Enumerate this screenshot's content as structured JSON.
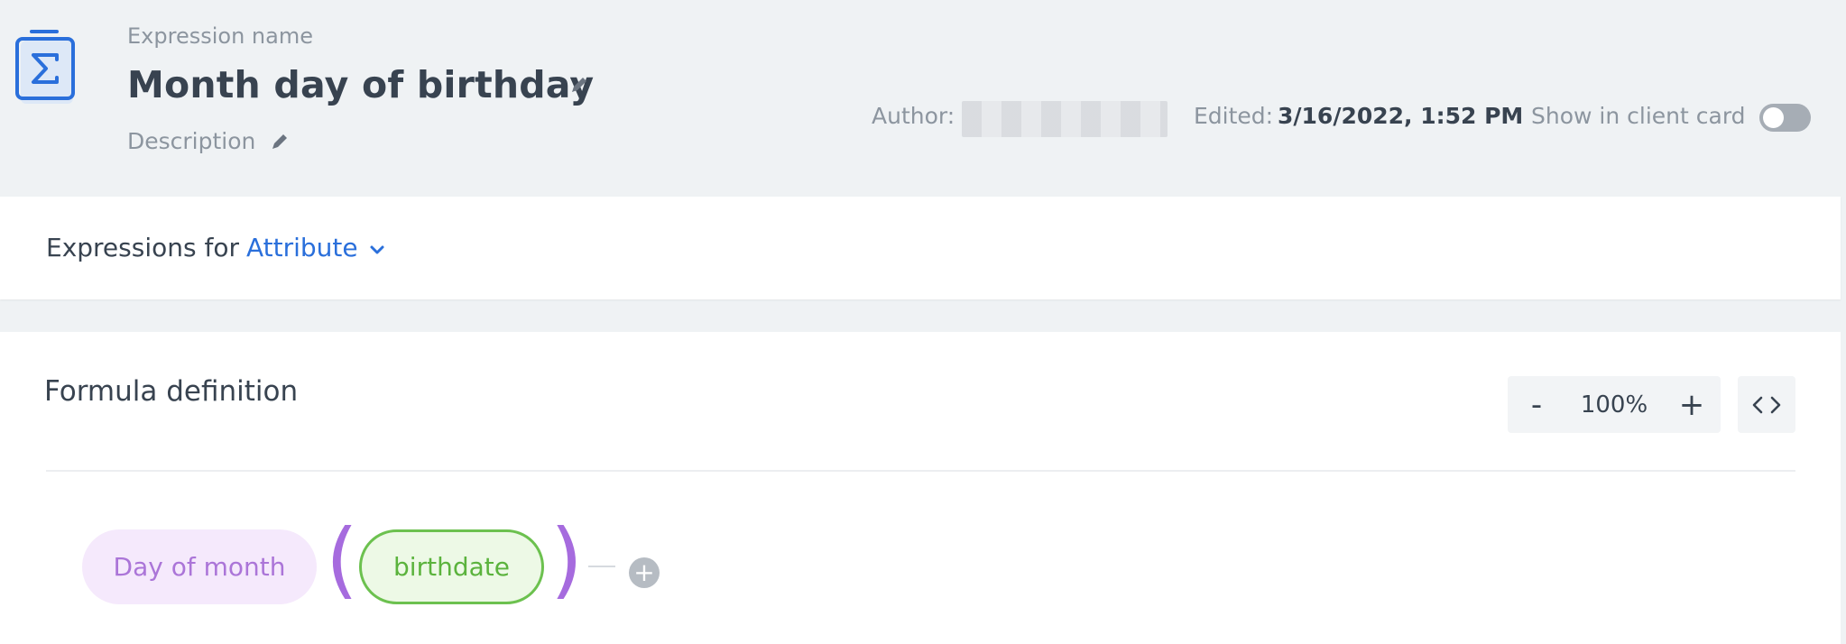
{
  "header": {
    "expression_label": "Expression name",
    "expression_name": "Month day of birthday",
    "description_placeholder": "Description",
    "author_label": "Author:",
    "edited_label": "Edited:",
    "edited_value": "3/16/2022, 1:52 PM",
    "show_in_card_label": "Show in client card",
    "show_in_card_enabled": false
  },
  "expressions_for": {
    "label": "Expressions for",
    "selected": "Attribute"
  },
  "formula": {
    "title": "Formula definition",
    "zoom_minus": "-",
    "zoom_value": "100%",
    "zoom_plus": "+",
    "function_label": "Day of month",
    "argument_label": "birthdate",
    "open_paren": "(",
    "close_paren": ")",
    "add_symbol": "+"
  },
  "colors": {
    "accent_blue": "#2a6fdb",
    "function_purple": "#ab75d8",
    "argument_green": "#6cc14f"
  },
  "icons": [
    "sigma-expression-icon",
    "pencil-icon",
    "chevron-down-icon",
    "code-icon",
    "plus-icon"
  ]
}
